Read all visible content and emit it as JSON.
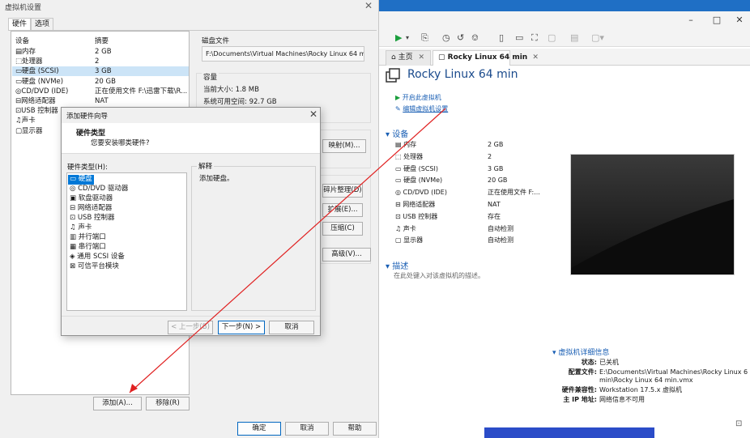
{
  "settings_dialog": {
    "title": "虚拟机设置",
    "tabs": [
      "硬件",
      "选项"
    ],
    "list_headers": {
      "device": "设备",
      "summary": "摘要"
    },
    "hardware": [
      {
        "name": "内存",
        "value": "2 GB",
        "icon": "memory-icon"
      },
      {
        "name": "处理器",
        "value": "2",
        "icon": "cpu-icon"
      },
      {
        "name": "硬盘 (SCSI)",
        "value": "3 GB",
        "icon": "disk-icon",
        "selected": true
      },
      {
        "name": "硬盘 (NVMe)",
        "value": "20 GB",
        "icon": "disk-icon"
      },
      {
        "name": "CD/DVD (IDE)",
        "value": "正在使用文件 F:\\迅雷下载\\R...",
        "icon": "cd-icon"
      },
      {
        "name": "网络适配器",
        "value": "NAT",
        "icon": "network-icon"
      },
      {
        "name": "USB 控制器",
        "value": "",
        "icon": "usb-icon"
      },
      {
        "name": "声卡",
        "value": "",
        "icon": "sound-icon"
      },
      {
        "name": "显示器",
        "value": "",
        "icon": "display-icon"
      }
    ],
    "disk_file_label": "磁盘文件",
    "disk_file_value": "F:\\Documents\\Virtual Machines\\Rocky Linux 64 min\\R",
    "capacity_label": "容量",
    "current_size": "当前大小: 1.8 MB",
    "free_space": "系统可用空间: 92.7 GB",
    "buttons": {
      "map": "映射(M)...",
      "defrag": "碎片整理(D)",
      "expand": "扩展(E)...",
      "compact": "压缩(C)",
      "advanced": "高级(V)...",
      "add": "添加(A)...",
      "remove": "移除(R)",
      "ok": "确定",
      "cancel": "取消",
      "help": "帮助"
    }
  },
  "wizard": {
    "title": "添加硬件向导",
    "header_title": "硬件类型",
    "header_subtitle": "您要安装哪类硬件?",
    "list_label": "硬件类型(H):",
    "explain_label": "解释",
    "explain_text": "添加硬盘。",
    "items": [
      "硬盘",
      "CD/DVD 驱动器",
      "软盘驱动器",
      "网络适配器",
      "USB 控制器",
      "声卡",
      "并行端口",
      "串行端口",
      "通用 SCSI 设备",
      "可信平台模块"
    ],
    "buttons": {
      "back": "< 上一步(B)",
      "next": "下一步(N) >",
      "cancel": "取消"
    }
  },
  "vmware": {
    "window_buttons": {
      "minimize": "–",
      "maximize": "□",
      "close": "✕"
    },
    "tabs": [
      {
        "label": "主页"
      },
      {
        "label": "Rocky Linux 64 min"
      }
    ],
    "vm_name": "Rocky Linux 64 min",
    "actions": {
      "power_on": "开启此虚拟机",
      "edit": "编辑虚拟机设置"
    },
    "devices_header": "设备",
    "devices": [
      {
        "name": "内存",
        "value": "2 GB"
      },
      {
        "name": "处理器",
        "value": "2"
      },
      {
        "name": "硬盘 (SCSI)",
        "value": "3 GB"
      },
      {
        "name": "硬盘 (NVMe)",
        "value": "20 GB"
      },
      {
        "name": "CD/DVD (IDE)",
        "value": "正在使用文件 F:..."
      },
      {
        "name": "网络适配器",
        "value": "NAT"
      },
      {
        "name": "USB 控制器",
        "value": "存在"
      },
      {
        "name": "声卡",
        "value": "自动检测"
      },
      {
        "name": "显示器",
        "value": "自动检测"
      }
    ],
    "description_header": "描述",
    "description_placeholder": "在此处键入对该虚拟机的描述。",
    "details_header": "虚拟机详细信息",
    "details": {
      "status_label": "状态:",
      "status": "已关机",
      "config_label": "配置文件:",
      "config_line1": "E:\\Documents\\Virtual Machines\\Rocky Linux 6",
      "config_line2": "min\\Rocky Linux 64 min.vmx",
      "compat_label": "硬件兼容性:",
      "compat": "Workstation 17.5.x 虚拟机",
      "ip_label": "主 IP 地址:",
      "ip": "网络信息不可用"
    }
  },
  "colors": {
    "accent": "#1a5fb4",
    "selection": "#0078d7",
    "arrow": "#e02020",
    "play": "#1a9e3c"
  }
}
